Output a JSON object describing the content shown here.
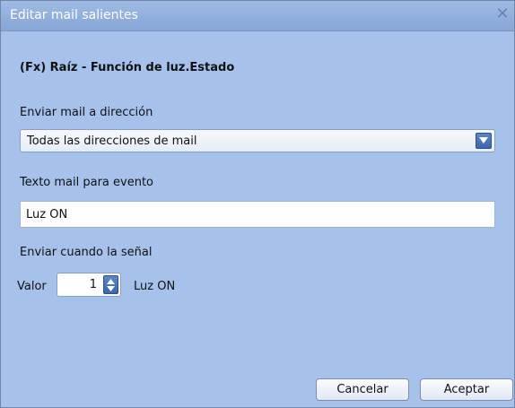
{
  "window": {
    "title": "Editar mail salientes",
    "close_symbol": "✕"
  },
  "heading": "(Fx) Raíz - Función de luz.Estado",
  "address": {
    "label": "Enviar mail a dirección",
    "selected": "Todas las direcciones de mail"
  },
  "event_text": {
    "label": "Texto mail para evento",
    "value": "Luz ON"
  },
  "signal": {
    "label": "Enviar cuando la señal",
    "valor_label": "Valor",
    "value": "1",
    "value_name": "Luz ON"
  },
  "buttons": {
    "cancel": "Cancelar",
    "accept": "Aceptar"
  }
}
